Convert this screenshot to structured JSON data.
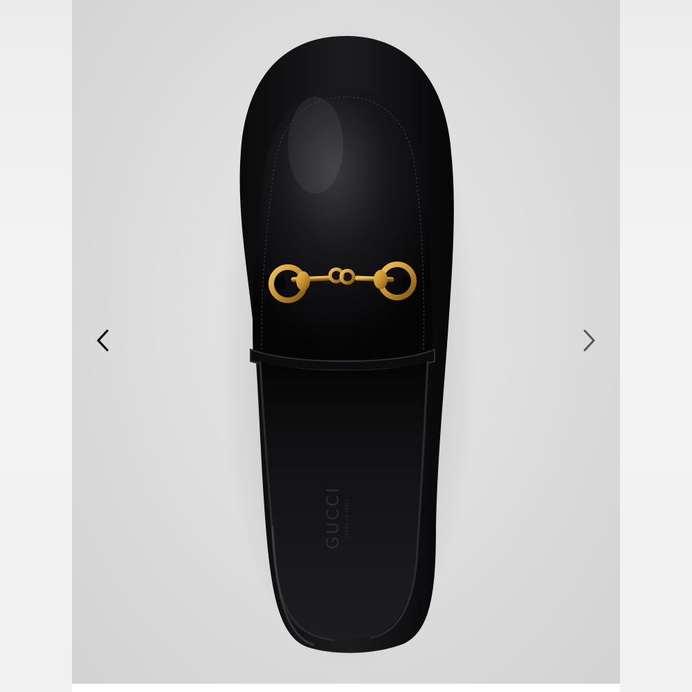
{
  "gallery": {
    "image_alt": "Black leather horsebit loafer, top view",
    "insole_brand": "GUCCI",
    "insole_subtext": "MADE IN ITALY",
    "prev_icon": "chevron-left-icon",
    "next_icon": "chevron-right-icon"
  },
  "colors": {
    "leather": "#0d0d0f",
    "hardware": "#c9962b",
    "background": "#dedede",
    "arrow_prev": "#111111",
    "arrow_next": "#555555"
  }
}
